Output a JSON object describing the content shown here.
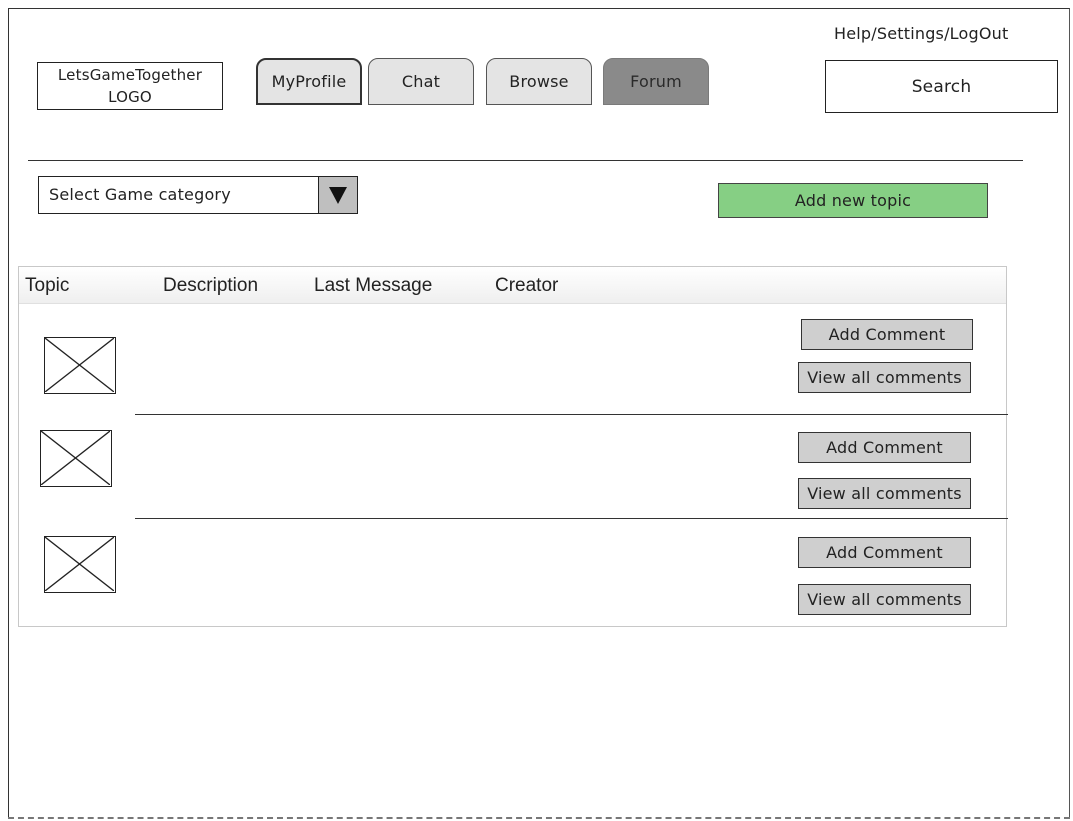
{
  "header": {
    "help_settings_logout": "Help/Settings/LogOut",
    "logo": {
      "line1": "LetsGameTogether",
      "line2": "LOGO"
    },
    "search_label": "Search"
  },
  "nav": {
    "tabs": [
      {
        "label": "MyProfile"
      },
      {
        "label": "Chat"
      },
      {
        "label": "Browse"
      },
      {
        "label": "Forum",
        "selected": true
      }
    ]
  },
  "filters": {
    "category_select": "Select Game category",
    "add_topic_label": "Add new topic"
  },
  "table": {
    "columns": [
      "Topic",
      "Description",
      "Last Message",
      "Creator"
    ],
    "rows": [
      {
        "add_comment": "Add Comment",
        "view_all": "View all comments"
      },
      {
        "add_comment": "Add Comment",
        "view_all": "View all comments"
      },
      {
        "add_comment": "Add Comment",
        "view_all": "View all comments"
      }
    ]
  },
  "colors": {
    "add_topic_bg": "#86cf84",
    "forum_tab_bg": "#8a8a8a",
    "tab_bg": "#e4e4e4",
    "button_bg": "#cfcfcf"
  },
  "icons": {
    "dropdown": "triangle-down-icon",
    "thumbnail": "image-placeholder-icon"
  }
}
